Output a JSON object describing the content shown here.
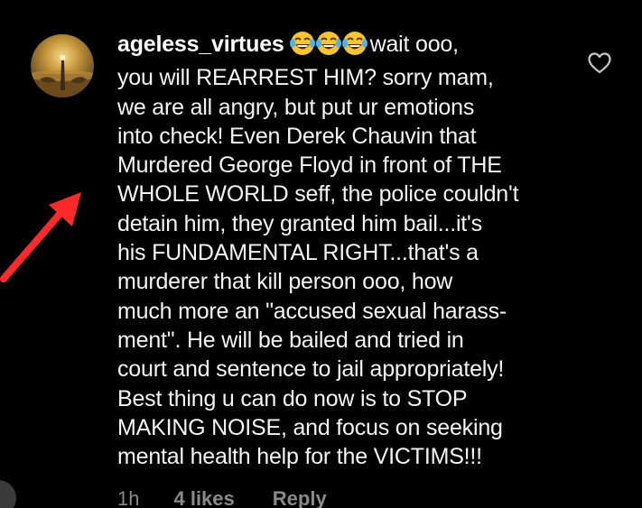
{
  "comment": {
    "username": "ageless_virtues",
    "emoji": "face-with-tears-of-joy",
    "emoji_count": 3,
    "first_line_text": "wait ooo,",
    "lines": [
      "you will REARREST HIM? sorry mam,",
      "we are all angry, but put ur emotions",
      "into check! Even Derek Chauvin that",
      "Murdered George Floyd in front of THE",
      "WHOLE WORLD seff, the police couldn't",
      "detain him, they granted him bail...it's",
      "his FUNDAMENTAL RIGHT...that's a",
      "murderer that kill person ooo, how",
      "much more an \"accused sexual harass-",
      "ment\". He will be bailed and tried in",
      "court and sentence to jail appropriately!",
      "Best thing u can do now is to STOP",
      "MAKING NOISE, and focus on seeking",
      "mental health help for the VICTIMS!!!"
    ]
  },
  "meta": {
    "time": "1h",
    "likes": "4 likes",
    "reply": "Reply"
  },
  "icons": {
    "like": "heart-outline-icon",
    "annotation": "red-arrow"
  },
  "colors": {
    "background": "#000000",
    "text": "#f4f4f4",
    "meta": "#8a8a8a",
    "arrow": "#ff2a2a"
  }
}
